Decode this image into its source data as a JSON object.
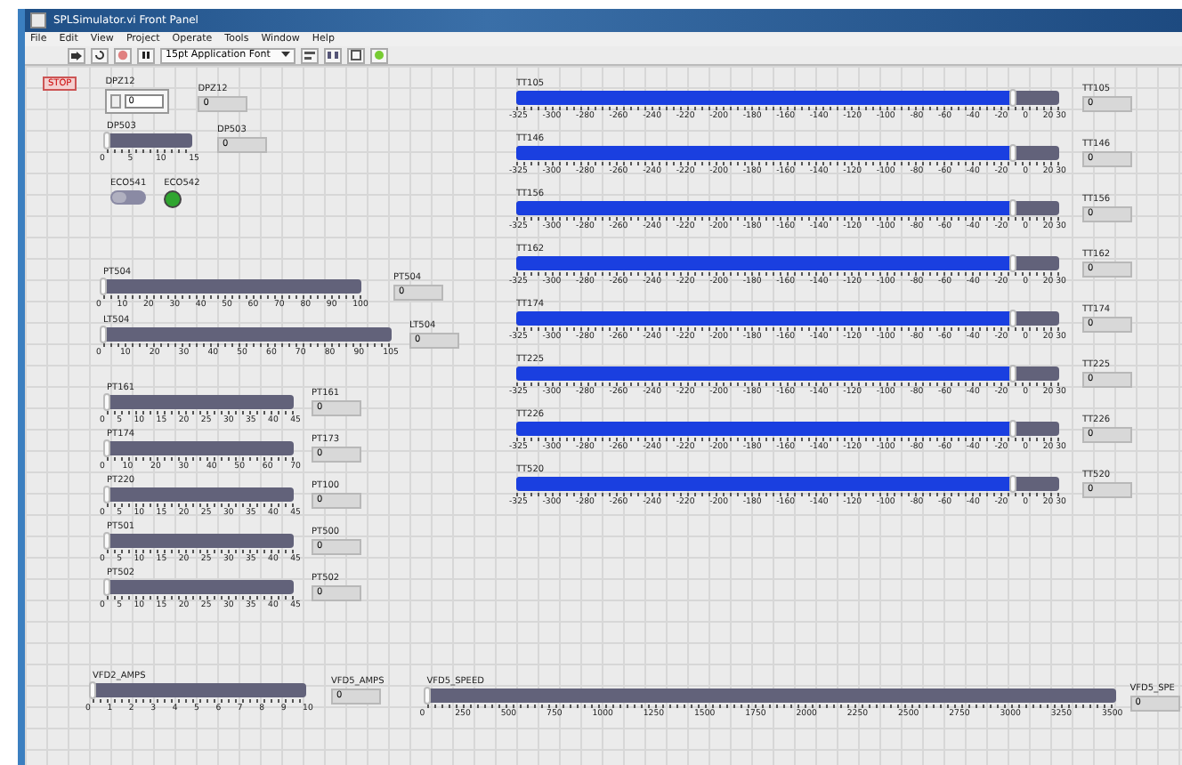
{
  "window": {
    "title": "SPLSimulator.vi Front Panel"
  },
  "menu": [
    "File",
    "Edit",
    "View",
    "Project",
    "Operate",
    "Tools",
    "Window",
    "Help"
  ],
  "toolbar": {
    "font": "15pt Application Font"
  },
  "stop_button": {
    "label": "STOP"
  },
  "dpz12": {
    "control": {
      "label": "DPZ12",
      "value": "0"
    },
    "indicator": {
      "label": "DPZ12",
      "value": "0"
    }
  },
  "dp503": {
    "label": "DP503",
    "level": 0,
    "ticks": [
      "0",
      "5",
      "10",
      "15"
    ],
    "indicator": {
      "label": "DP503",
      "value": "0"
    }
  },
  "eco541": {
    "label": "ECO541",
    "on": false
  },
  "eco542": {
    "label": "ECO542",
    "on": true
  },
  "level_sliders": [
    {
      "label": "PT504",
      "level": 0,
      "ticks": [
        "0",
        "10",
        "20",
        "30",
        "40",
        "50",
        "60",
        "70",
        "80",
        "90",
        "100"
      ],
      "indicator": {
        "label": "PT504",
        "value": "0"
      }
    },
    {
      "label": "LT504",
      "level": 0,
      "ticks": [
        "0",
        "10",
        "20",
        "30",
        "40",
        "50",
        "60",
        "70",
        "80",
        "90",
        "105"
      ],
      "indicator": {
        "label": "LT504",
        "value": "0"
      }
    }
  ],
  "pressure_sliders": [
    {
      "label": "PT161",
      "level": 0,
      "ticks": [
        "0",
        "5",
        "10",
        "15",
        "20",
        "25",
        "30",
        "35",
        "40",
        "45"
      ],
      "indicator": {
        "label": "PT161",
        "value": "0"
      }
    },
    {
      "label": "PT174",
      "level": 0,
      "ticks": [
        "0",
        "10",
        "20",
        "30",
        "40",
        "50",
        "60",
        "70"
      ],
      "indicator": {
        "label": "PT173",
        "value": "0"
      }
    },
    {
      "label": "PT220",
      "level": 0,
      "ticks": [
        "0",
        "5",
        "10",
        "15",
        "20",
        "25",
        "30",
        "35",
        "40",
        "45"
      ],
      "indicator": {
        "label": "PT100",
        "value": "0"
      }
    },
    {
      "label": "PT501",
      "level": 0,
      "ticks": [
        "0",
        "5",
        "10",
        "15",
        "20",
        "25",
        "30",
        "35",
        "40",
        "45"
      ],
      "indicator": {
        "label": "PT500",
        "value": "0"
      }
    },
    {
      "label": "PT502",
      "level": 0,
      "ticks": [
        "0",
        "5",
        "10",
        "15",
        "20",
        "25",
        "30",
        "35",
        "40",
        "45"
      ],
      "indicator": {
        "label": "PT502",
        "value": "0"
      }
    }
  ],
  "temperature_sliders": [
    {
      "label": "TT105",
      "level": 0.915,
      "ticks": [
        "-325",
        "-300",
        "-280",
        "-260",
        "-240",
        "-220",
        "-200",
        "-180",
        "-160",
        "-140",
        "-120",
        "-100",
        "-80",
        "-60",
        "-40",
        "-20",
        "0",
        "20 30"
      ],
      "indicator": {
        "label": "TT105",
        "value": "0"
      }
    },
    {
      "label": "TT146",
      "level": 0.915,
      "ticks": [
        "-325",
        "-300",
        "-280",
        "-260",
        "-240",
        "-220",
        "-200",
        "-180",
        "-160",
        "-140",
        "-120",
        "-100",
        "-80",
        "-60",
        "-40",
        "-20",
        "0",
        "20 30"
      ],
      "indicator": {
        "label": "TT146",
        "value": "0"
      }
    },
    {
      "label": "TT156",
      "level": 0.915,
      "ticks": [
        "-325",
        "-300",
        "-280",
        "-260",
        "-240",
        "-220",
        "-200",
        "-180",
        "-160",
        "-140",
        "-120",
        "-100",
        "-80",
        "-60",
        "-40",
        "-20",
        "0",
        "20 30"
      ],
      "indicator": {
        "label": "TT156",
        "value": "0"
      }
    },
    {
      "label": "TT162",
      "level": 0.915,
      "ticks": [
        "-325",
        "-300",
        "-280",
        "-260",
        "-240",
        "-220",
        "-200",
        "-180",
        "-160",
        "-140",
        "-120",
        "-100",
        "-80",
        "-60",
        "-40",
        "-20",
        "0",
        "20 30"
      ],
      "indicator": {
        "label": "TT162",
        "value": "0"
      }
    },
    {
      "label": "TT174",
      "level": 0.915,
      "ticks": [
        "-325",
        "-300",
        "-280",
        "-260",
        "-240",
        "-220",
        "-200",
        "-180",
        "-160",
        "-140",
        "-120",
        "-100",
        "-80",
        "-60",
        "-40",
        "-20",
        "0",
        "20 30"
      ],
      "indicator": {
        "label": "TT174",
        "value": "0"
      }
    },
    {
      "label": "TT225",
      "level": 0.915,
      "ticks": [
        "-325",
        "-300",
        "-280",
        "-260",
        "-240",
        "-220",
        "-200",
        "-180",
        "-160",
        "-140",
        "-120",
        "-100",
        "-80",
        "-60",
        "-40",
        "-20",
        "0",
        "20 30"
      ],
      "indicator": {
        "label": "TT225",
        "value": "0"
      }
    },
    {
      "label": "TT226",
      "level": 0.915,
      "ticks": [
        "-325",
        "-300",
        "-280",
        "-260",
        "-240",
        "-220",
        "-200",
        "-180",
        "-160",
        "-140",
        "-120",
        "-100",
        "-80",
        "-60",
        "-40",
        "-20",
        "0",
        "20 30"
      ],
      "indicator": {
        "label": "TT226",
        "value": "0"
      }
    },
    {
      "label": "TT520",
      "level": 0.915,
      "ticks": [
        "-325",
        "-300",
        "-280",
        "-260",
        "-240",
        "-220",
        "-200",
        "-180",
        "-160",
        "-140",
        "-120",
        "-100",
        "-80",
        "-60",
        "-40",
        "-20",
        "0",
        "20 30"
      ],
      "indicator": {
        "label": "TT520",
        "value": "0"
      }
    }
  ],
  "vfd_amps": {
    "label": "VFD2_AMPS",
    "level": 0,
    "ticks": [
      "0",
      "1",
      "2",
      "3",
      "4",
      "5",
      "6",
      "7",
      "8",
      "9",
      "10"
    ],
    "indicator": {
      "label": "VFD5_AMPS",
      "value": "0"
    }
  },
  "vfd_speed": {
    "label": "VFD5_SPEED",
    "level": 0,
    "ticks": [
      "0",
      "250",
      "500",
      "750",
      "1000",
      "1250",
      "1500",
      "1750",
      "2000",
      "2250",
      "2500",
      "2750",
      "3000",
      "3250",
      "3500"
    ],
    "indicator": {
      "label": "VFD5_SPE",
      "value": "0"
    }
  }
}
